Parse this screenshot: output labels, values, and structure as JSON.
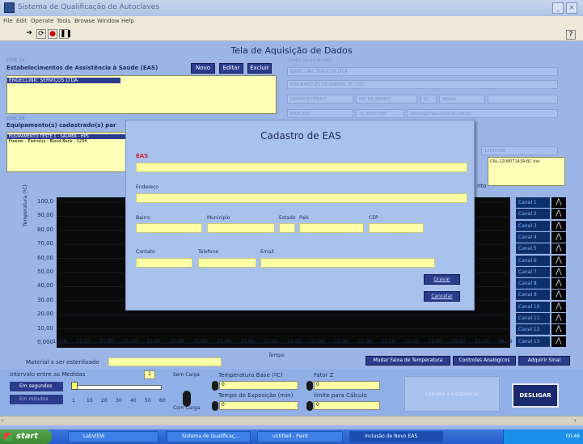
{
  "window": {
    "title": "Sistema de Qualificação de Autoclaves",
    "menu": [
      "File",
      "Edit",
      "Operate",
      "Tools",
      "Browse",
      "Window",
      "Help"
    ]
  },
  "page_title": "Tela de Aquisição de Dados",
  "eas_section": {
    "click_hint": "click 1x",
    "title": "Estabelecimentos de Assistência à Saúde (EAS)",
    "buttons": {
      "new": "Novo",
      "edit": "Editar",
      "delete": "Excluir"
    },
    "items": [
      "ENGECLINIC SERVIÇOS LTDA"
    ]
  },
  "equip_section": {
    "click_hint": "click 2x",
    "title": "Equipamento(s) cadastrado(s) par",
    "items": [
      "EQUIPAMENTO TESTE 1 - SALMER - HPS",
      "Freezer - Eletrolux - Blood Bank - 1234"
    ]
  },
  "eas_info": {
    "header": "Dados Gerais do EAS",
    "name": "ENGECLINIC SERVIÇOS LTDA",
    "address": "RUA MARQUÊS DE SABARÁ, 35 / 101",
    "district": "JARDIM BOTÂNICO",
    "city": "RIO DE JANEIRO",
    "state": "RJ",
    "country": "BRASIL",
    "contact": "MARCELO",
    "phone": "21 39137750",
    "email": "cliente@engeclinicinfo.com.br",
    "serial": "12345789",
    "file": "CAL-220807143A-BC.dat",
    "right_label": "nto"
  },
  "chart_data": {
    "type": "line",
    "ylabel": "Temperatura (ºC)",
    "xlabel": "Tempo",
    "ylim": [
      0,
      100
    ],
    "yticks": [
      "100,0",
      "90,00",
      "80,00",
      "70,00",
      "60,00",
      "50,00",
      "40,00",
      "30,00",
      "20,00",
      "10,00",
      "0,000"
    ],
    "xticks": [
      "17:06",
      "21:00",
      "21:00",
      "21:00",
      "21:00",
      "21:00",
      "21:00",
      "21:00",
      "21:00",
      "21:00",
      "21:00",
      "21:00",
      "21:00",
      "21:00",
      "21:00",
      "21:00",
      "21:00",
      "21:00",
      "21:00",
      "08:19"
    ],
    "series": []
  },
  "channels": [
    "Canal 1",
    "Canal 2",
    "Canal 3",
    "Canal 4",
    "Canal 5",
    "Canal 6",
    "Canal 7",
    "Canal 8",
    "Canal 9",
    "Canal 10",
    "Canal 11",
    "Canal 12",
    "Canal 13"
  ],
  "material_label": "Material a ser esterilizado",
  "chart_buttons": {
    "temp_range": "Mudar Faixa de Temperatura",
    "analog": "Controles Analógicos",
    "acquire": "Adquirir Sinal"
  },
  "bottom": {
    "interval_label": "Intervalo entre as Medidas",
    "interval_value": "1",
    "unit_seconds": "Em segundos",
    "unit_minutes": "Em minutos",
    "slider_ticks": [
      "1",
      "10",
      "20",
      "30",
      "40",
      "50",
      "60"
    ],
    "no_load": "Sem Carga",
    "with_load": "Com Carga",
    "base_temp_label": "Temperatura Base (ºC)",
    "base_temp_value": "0",
    "exposure_label": "Tempo de Exposição (min)",
    "exposure_value": "0",
    "z_label": "Fator Z",
    "z_value": "0",
    "limit_label": "limite para Cálculo",
    "limit_value": "0",
    "calc_button": "Cálculos e Estatísticas",
    "off_button": "DESLIGAR"
  },
  "dialog": {
    "title": "Cadastro de EAS",
    "eas_label": "EAS",
    "address_label": "Endereço",
    "district_label": "Bairro",
    "city_label": "Município",
    "state_label": "Estado",
    "country_label": "País",
    "zip_label": "CEP",
    "contact_label": "Contato",
    "phone_label": "Telefone",
    "email_label": "Email",
    "save": "Gravar",
    "cancel": "Cancelar"
  },
  "taskbar": {
    "start": "start",
    "tasks": [
      "LabVIEW",
      "Sistema de Qualificaç...",
      "untitled - Paint",
      "Inclusão de Novo EAS"
    ],
    "clock": "00:48"
  },
  "colors": {
    "panel_bg": "#9ab5e6",
    "field_yellow": "#ffffa6",
    "button_navy": "#2b3c8e"
  }
}
